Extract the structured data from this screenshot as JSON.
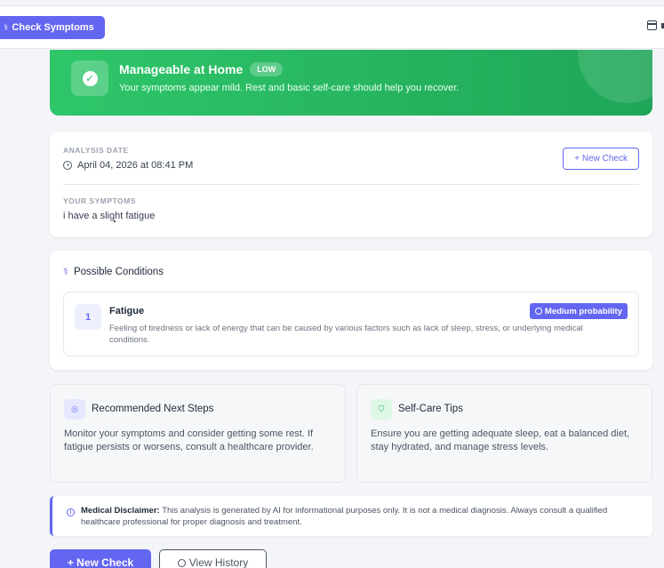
{
  "header": {
    "check_button": "Check Symptoms",
    "calendar_icon": "calendar-icon"
  },
  "banner": {
    "title": "Manageable at Home",
    "level": "LOW",
    "subtitle": "Your symptoms appear mild. Rest and basic self-care should help you recover.",
    "color": "#22b45f"
  },
  "analysis": {
    "date_label": "ANALYSIS DATE",
    "date_value": "April 04, 2026 at 08:41 PM",
    "new_check_label": "+ New Check",
    "symptoms_label": "YOUR SYMPTOMS",
    "symptoms_value": "i have a slight fatigue"
  },
  "conditions": {
    "title": "Possible Conditions",
    "items": [
      {
        "rank": "1",
        "name": "Fatigue",
        "probability": "Medium probability",
        "description": "Feeling of tiredness or lack of energy that can be caused by various factors such as lack of sleep, stress, or underlying medical conditions."
      }
    ]
  },
  "next_steps": {
    "title": "Recommended Next Steps",
    "body": "Monitor your symptoms and consider getting some rest. If fatigue persists or worsens, consult a healthcare provider."
  },
  "self_care": {
    "title": "Self-Care Tips",
    "body": "Ensure you are getting adequate sleep, eat a balanced diet, stay hydrated, and manage stress levels."
  },
  "disclaimer": {
    "label": "Medical Disclaimer:",
    "text": "This analysis is generated by AI for informational purposes only. It is not a medical diagnosis. Always consult a qualified healthcare professional for proper diagnosis and treatment."
  },
  "actions": {
    "new_check": "+ New Check",
    "view_history": "View History"
  },
  "accent_color": "#6366f1"
}
